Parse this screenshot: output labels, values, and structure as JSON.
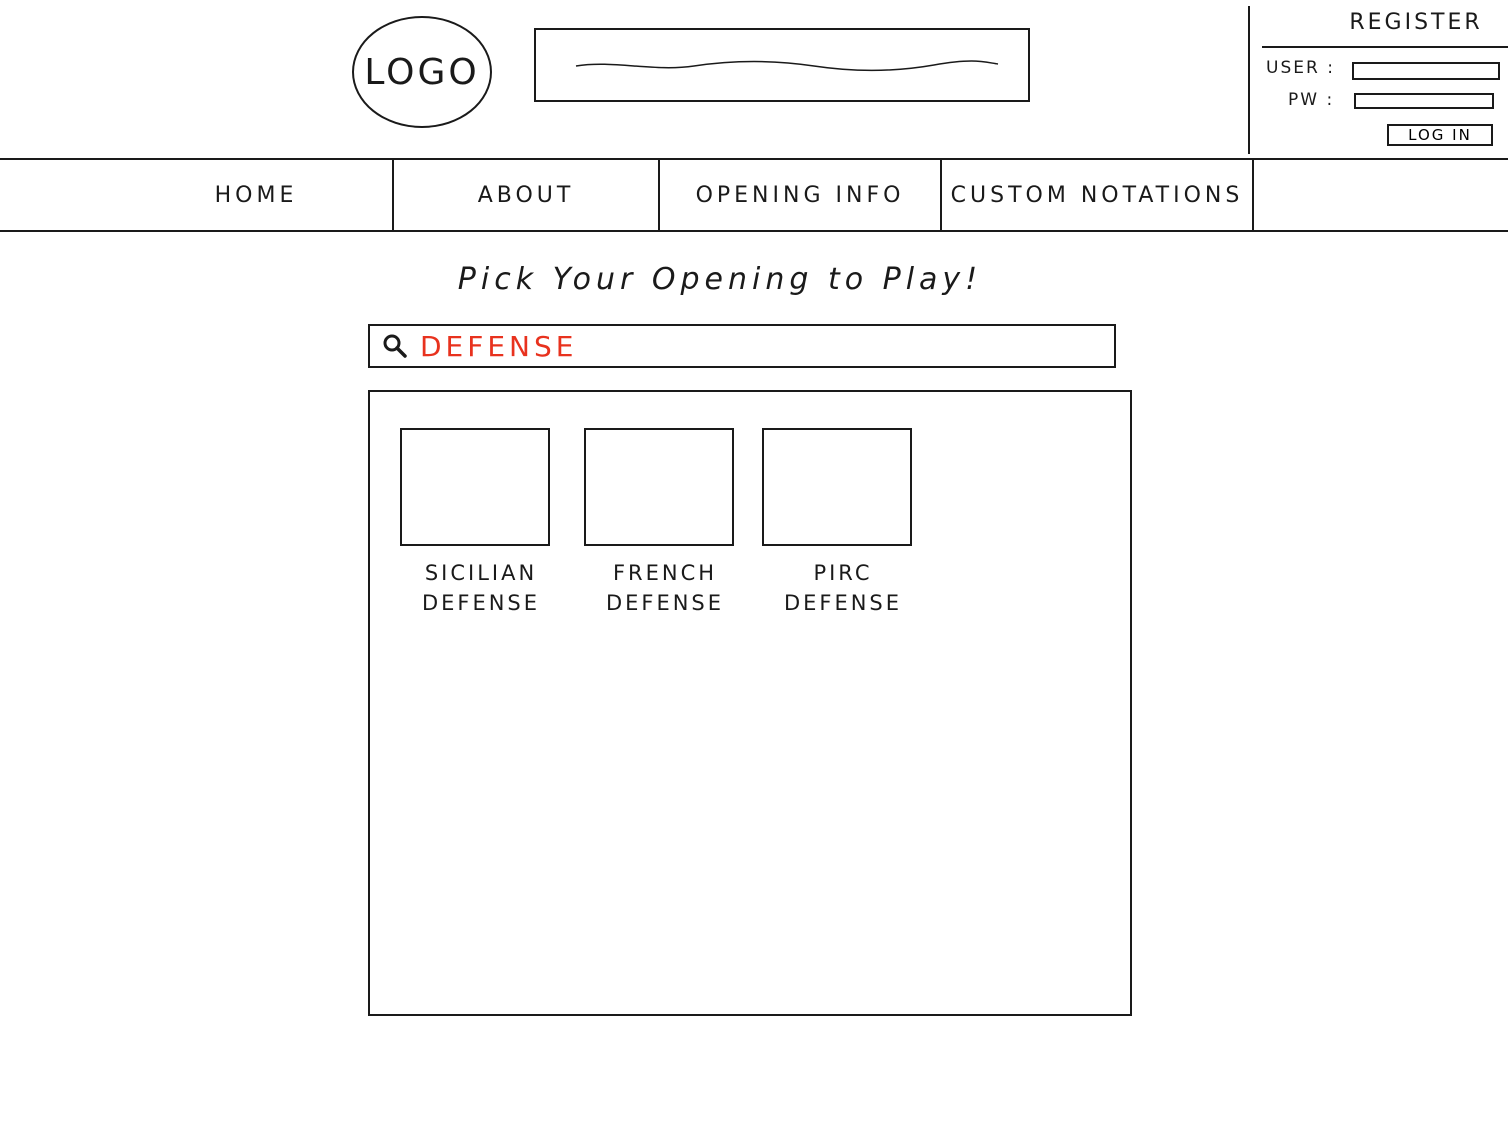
{
  "header": {
    "logo_text": "LOGO",
    "register_label": "REGISTER",
    "user_label": "USER :",
    "pw_label": "PW :",
    "login_label": "LOG IN"
  },
  "nav": {
    "items": [
      {
        "label": "HOME"
      },
      {
        "label": "ABOUT"
      },
      {
        "label": "OPENING INFO"
      },
      {
        "label": "CUSTOM NOTATIONS"
      }
    ]
  },
  "main": {
    "title": "Pick Your Opening to Play!",
    "search": {
      "value": "DEFENSE",
      "text_color": "#e8321e"
    },
    "results": [
      {
        "label": "SICILIAN\nDEFENSE"
      },
      {
        "label": "FRENCH\nDEFENSE"
      },
      {
        "label": "PIRC\nDEFENSE"
      }
    ]
  }
}
